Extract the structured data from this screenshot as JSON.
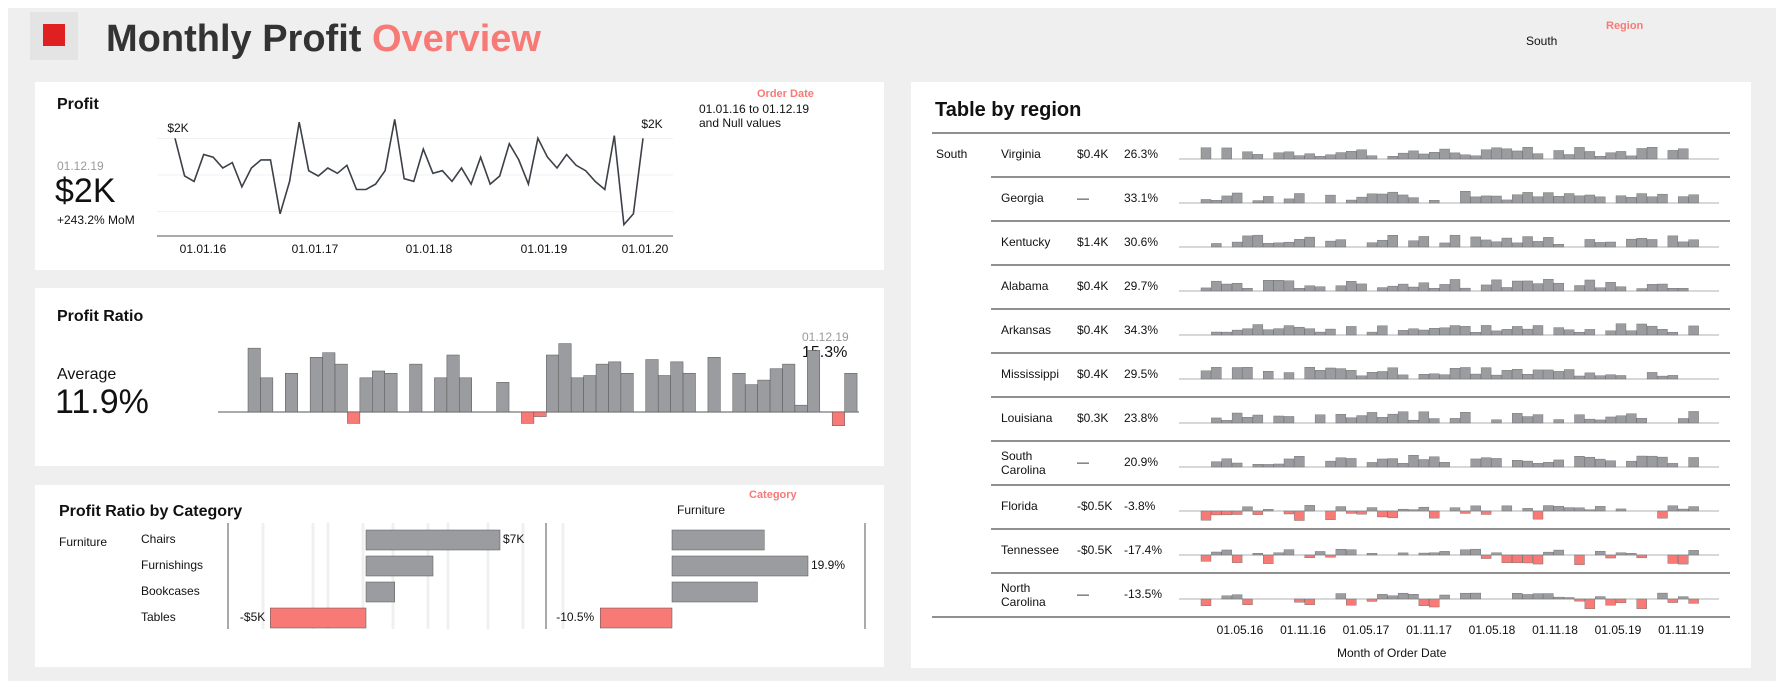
{
  "header": {
    "title_main": "Monthly Profit",
    "title_accent": "Overview",
    "region_filter_label": "Region",
    "region_filter_value": "South"
  },
  "colors": {
    "accent": "#f87a77",
    "bar": "#9a9ca0",
    "negative": "#f87a77",
    "line": "#3c4048",
    "logo": "#e02020"
  },
  "profit_card": {
    "title": "Profit",
    "date": "01.12.19",
    "value": "$2K",
    "change": "+243.2% MoM",
    "filter_label": "Order Date",
    "filter_line1": "01.01.16 to 01.12.19",
    "filter_line2": "and Null values"
  },
  "ratio_card": {
    "title": "Profit Ratio",
    "avg_label": "Average",
    "avg_value": "11.9%",
    "last_date": "01.12.19",
    "last_value": "15.3%"
  },
  "category_card": {
    "title": "Profit Ratio by Category",
    "filter_label": "Category",
    "filter_value": "Furniture",
    "category": "Furniture"
  },
  "table_card": {
    "title": "Table by region",
    "region": "South",
    "x_axis_label": "Month of Order Date"
  },
  "chart_data": [
    {
      "type": "line",
      "name": "profit",
      "x_ticks": [
        "01.01.16",
        "01.01.17",
        "01.01.18",
        "01.01.19",
        "01.01.20"
      ],
      "start_label": "$2K",
      "end_label": "$2K",
      "values": [
        2.0,
        0.6,
        0.4,
        1.4,
        1.3,
        0.9,
        1.1,
        0.2,
        0.9,
        1.2,
        1.2,
        -0.8,
        0.4,
        2.6,
        0.8,
        0.6,
        0.9,
        0.7,
        1.0,
        0.1,
        0.1,
        0.3,
        0.8,
        2.7,
        0.5,
        0.4,
        1.6,
        0.7,
        0.8,
        0.4,
        0.9,
        0.3,
        1.3,
        0.3,
        0.6,
        1.8,
        1.2,
        0.3,
        2.0,
        1.3,
        0.9,
        1.4,
        1.0,
        0.8,
        0.4,
        0.1,
        2.1,
        -1.2,
        -0.8,
        2.0
      ]
    },
    {
      "type": "bar",
      "name": "profit_ratio",
      "values": [
        0.28,
        0.15,
        0.0,
        0.17,
        0.0,
        0.24,
        0.26,
        0.21,
        -0.05,
        0.15,
        0.18,
        0.17,
        0.0,
        0.21,
        0.0,
        0.15,
        0.25,
        0.15,
        0.0,
        0.0,
        0.13,
        0.0,
        -0.05,
        -0.02,
        0.25,
        0.3,
        0.15,
        0.16,
        0.21,
        0.22,
        0.17,
        0.0,
        0.23,
        0.16,
        0.22,
        0.17,
        0.0,
        0.24,
        0.0,
        0.17,
        0.12,
        0.14,
        0.19,
        0.21,
        0.03,
        0.27,
        0.0,
        -0.06,
        0.17
      ]
    },
    {
      "type": "bar",
      "name": "profit_by_subcategory",
      "orientation": "horizontal",
      "categories": [
        "Chairs",
        "Furnishings",
        "Bookcases",
        "Tables"
      ],
      "values": [
        7,
        3.5,
        1.5,
        -5
      ],
      "data_labels": [
        "$7K",
        "",
        "",
        "-$5K"
      ]
    },
    {
      "type": "bar",
      "name": "profit_ratio_by_subcategory",
      "orientation": "horizontal",
      "categories": [
        "Chairs",
        "Furnishings",
        "Bookcases",
        "Tables"
      ],
      "values": [
        13.5,
        19.9,
        12.5,
        -10.5
      ],
      "data_labels": [
        "",
        "19.9%",
        "",
        "-10.5%"
      ]
    },
    {
      "type": "table",
      "name": "table_by_region",
      "x_ticks": [
        "01.05.16",
        "01.11.16",
        "01.05.17",
        "01.11.17",
        "01.05.18",
        "01.11.18",
        "01.05.19",
        "01.11.19"
      ],
      "x_label": "Month of Order Date",
      "rows": [
        {
          "state": "Virginia",
          "profit": "$0.4K",
          "ratio": "26.3%",
          "region": "South"
        },
        {
          "state": "Georgia",
          "profit": "—",
          "ratio": "33.1%"
        },
        {
          "state": "Kentucky",
          "profit": "$1.4K",
          "ratio": "30.6%"
        },
        {
          "state": "Alabama",
          "profit": "$0.4K",
          "ratio": "29.7%"
        },
        {
          "state": "Arkansas",
          "profit": "$0.4K",
          "ratio": "34.3%"
        },
        {
          "state": "Mississippi",
          "profit": "$0.4K",
          "ratio": "29.5%"
        },
        {
          "state": "Louisiana",
          "profit": "$0.3K",
          "ratio": "23.8%"
        },
        {
          "state": "South Carolina",
          "state_l1": "South",
          "state_l2": "Carolina",
          "profit": "—",
          "ratio": "20.9%"
        },
        {
          "state": "Florida",
          "profit": "-$0.5K",
          "ratio": "-3.8%"
        },
        {
          "state": "Tennessee",
          "profit": "-$0.5K",
          "ratio": "-17.4%"
        },
        {
          "state": "North Carolina",
          "state_l1": "North",
          "state_l2": "Carolina",
          "profit": "—",
          "ratio": "-13.5%"
        }
      ]
    }
  ]
}
